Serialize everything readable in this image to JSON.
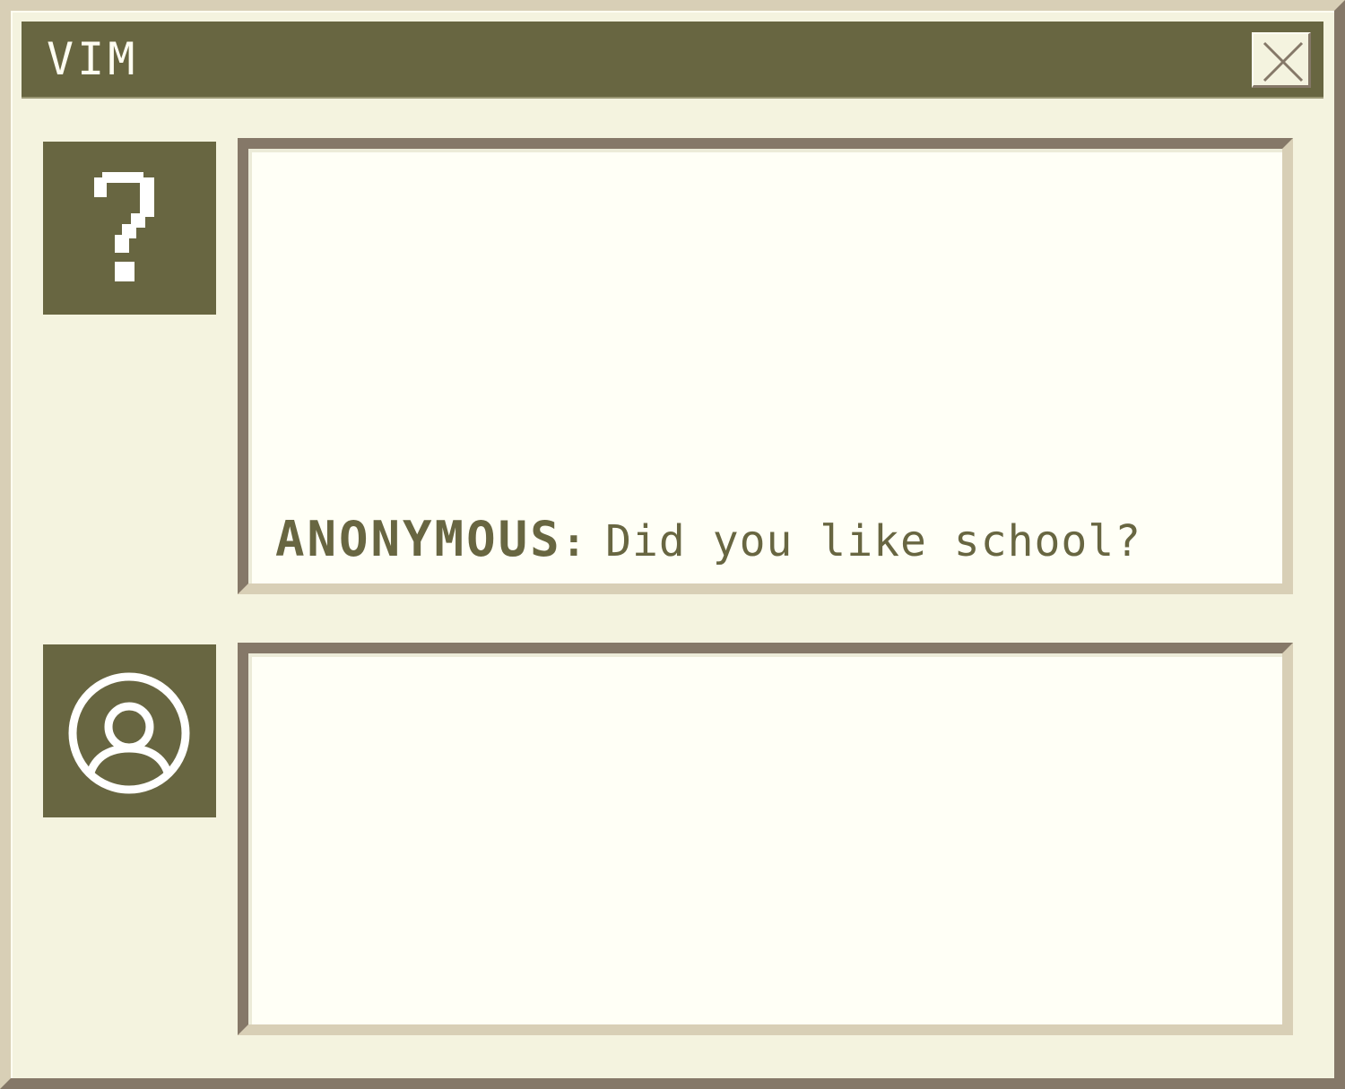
{
  "window": {
    "title": "VIM",
    "close_label": "close"
  },
  "chat": {
    "messages": [
      {
        "sender": "ANONYMOUS",
        "separator": ":",
        "text": "Did you like school?"
      }
    ]
  },
  "input": {
    "value": ""
  },
  "icons": {
    "stranger": "question-mark-icon",
    "self": "user-avatar-icon",
    "close": "close-icon"
  },
  "colors": {
    "accent": "#686641",
    "background": "#f4f3df",
    "panel": "#fffff6",
    "bevel_dark": "#857868",
    "bevel_light": "#d8cfb6"
  }
}
